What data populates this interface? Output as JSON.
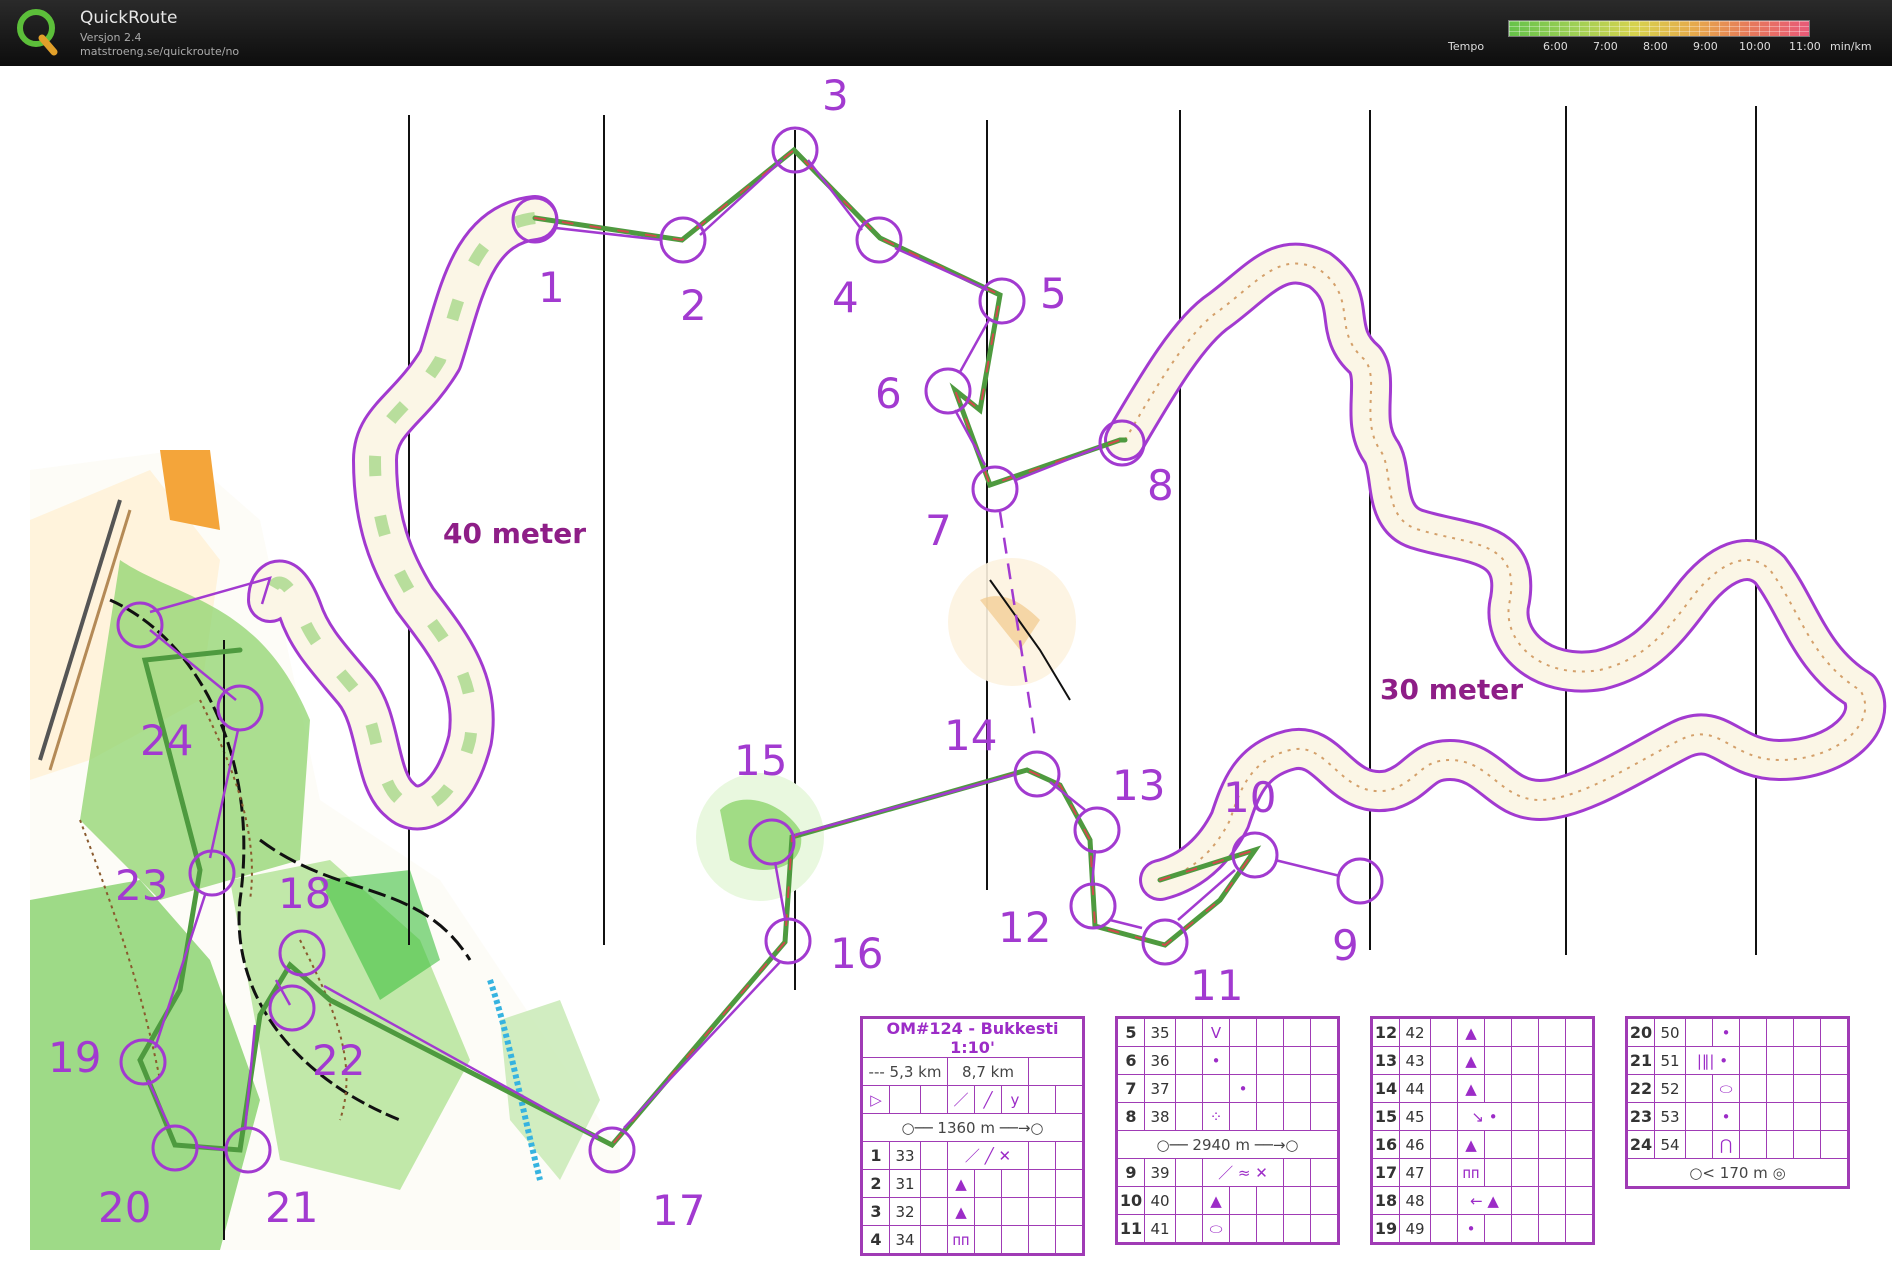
{
  "app": {
    "title": "QuickRoute",
    "version": "Versjon 2.4",
    "url": "matstroeng.se/quickroute/no"
  },
  "tempo": {
    "label": "Tempo",
    "ticks": [
      "6:00",
      "7:00",
      "8:00",
      "9:00",
      "10:00",
      "11:00"
    ],
    "unit": "min/km"
  },
  "map": {
    "labels": {
      "width_40": "40 meter",
      "width_30": "30 meter"
    },
    "controls": [
      "1",
      "2",
      "3",
      "4",
      "5",
      "6",
      "7",
      "8",
      "9",
      "10",
      "11",
      "12",
      "13",
      "14",
      "15",
      "16",
      "17",
      "18",
      "19",
      "20",
      "21",
      "22",
      "23",
      "24"
    ]
  },
  "course": {
    "title": "OM#124 - Bukkesti 1:10'",
    "length_a": "--- 5,3 km",
    "length_b": "8,7 km",
    "leg1_distance": "1360 m",
    "leg2_distance": "2940 m",
    "finish_distance": "170 m"
  },
  "descriptions": {
    "col1": [
      {
        "n": "1",
        "code": "33",
        "sym": "／ ╱ ✕"
      },
      {
        "n": "2",
        "code": "31",
        "sym": "▲"
      },
      {
        "n": "3",
        "code": "32",
        "sym": "▲"
      },
      {
        "n": "4",
        "code": "34",
        "sym": "ᴨᴨ"
      }
    ],
    "col2": [
      {
        "n": "5",
        "code": "35",
        "sym": "V"
      },
      {
        "n": "6",
        "code": "36",
        "sym": "•"
      },
      {
        "n": "7",
        "code": "37",
        "sym": "•"
      },
      {
        "n": "8",
        "code": "38",
        "sym": "⁘"
      },
      {
        "n": "9",
        "code": "39",
        "sym": "／ ≈ ✕"
      },
      {
        "n": "10",
        "code": "40",
        "sym": "▲"
      },
      {
        "n": "11",
        "code": "41",
        "sym": "⬭"
      }
    ],
    "col3": [
      {
        "n": "12",
        "code": "42",
        "sym": "▲"
      },
      {
        "n": "13",
        "code": "43",
        "sym": "▲"
      },
      {
        "n": "14",
        "code": "44",
        "sym": "▲"
      },
      {
        "n": "15",
        "code": "45",
        "sym": "↘ •"
      },
      {
        "n": "16",
        "code": "46",
        "sym": "▲"
      },
      {
        "n": "17",
        "code": "47",
        "sym": "ᴨᴨ"
      },
      {
        "n": "18",
        "code": "48",
        "sym": "← ▲"
      },
      {
        "n": "19",
        "code": "49",
        "sym": "•"
      }
    ],
    "col4": [
      {
        "n": "20",
        "code": "50",
        "sym": "•"
      },
      {
        "n": "21",
        "code": "51",
        "sym": "|‖| •"
      },
      {
        "n": "22",
        "code": "52",
        "sym": "⬭"
      },
      {
        "n": "23",
        "code": "53",
        "sym": "•"
      },
      {
        "n": "24",
        "code": "54",
        "sym": "⋂"
      }
    ]
  },
  "colors": {
    "course": "#a23ad0",
    "route_green": "#4e9a3f",
    "route_red": "#d14b4b"
  }
}
